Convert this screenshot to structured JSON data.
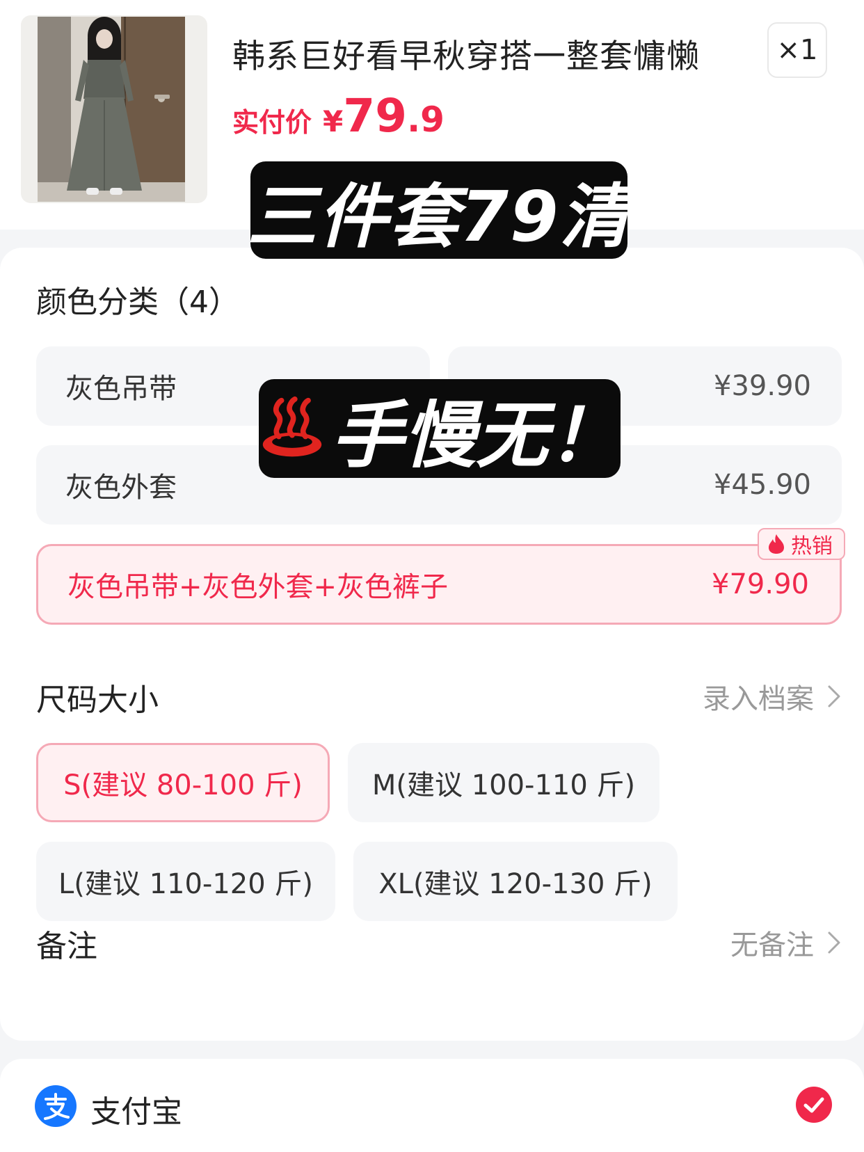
{
  "product": {
    "title": "韩系巨好看早秋穿搭一整套慵懒",
    "price_label": "实付价",
    "price_symbol": "¥",
    "price_int": "79",
    "price_dec": ".9",
    "quantity": "×1"
  },
  "stickers": {
    "top_text": "三件套79清",
    "middle_text": "手慢无！"
  },
  "color_section": {
    "title": "颜色分类（4）",
    "options": [
      {
        "name": "灰色吊带",
        "price": "",
        "selected": false
      },
      {
        "name": "",
        "price": "¥39.90",
        "selected": false
      },
      {
        "name": "灰色外套",
        "price": "¥45.90",
        "selected": false
      },
      {
        "name": "灰色吊带+灰色外套+灰色裤子",
        "price": "¥79.90",
        "selected": true,
        "badge": "热销"
      }
    ]
  },
  "size_section": {
    "title": "尺码大小",
    "profile_link": "录入档案",
    "options": [
      {
        "label": "S(建议 80-100 斤)",
        "selected": true
      },
      {
        "label": "M(建议 100-110 斤)",
        "selected": false
      },
      {
        "label": "L(建议 110-120 斤)",
        "selected": false
      },
      {
        "label": "XL(建议 120-130 斤)",
        "selected": false
      }
    ]
  },
  "remark": {
    "title": "备注",
    "value": "无备注"
  },
  "payment": {
    "method": "支付宝",
    "selected": true
  },
  "colors": {
    "accent": "#f0284b",
    "selected_bg": "#fff0f2",
    "selected_border": "#f5a9b6",
    "option_bg": "#f5f6f8",
    "alipay_blue": "#1677ff"
  },
  "icons": [
    "hot-spring-icon",
    "flame-icon",
    "chevron-right-icon",
    "alipay-logo-icon",
    "check-circle-icon"
  ]
}
